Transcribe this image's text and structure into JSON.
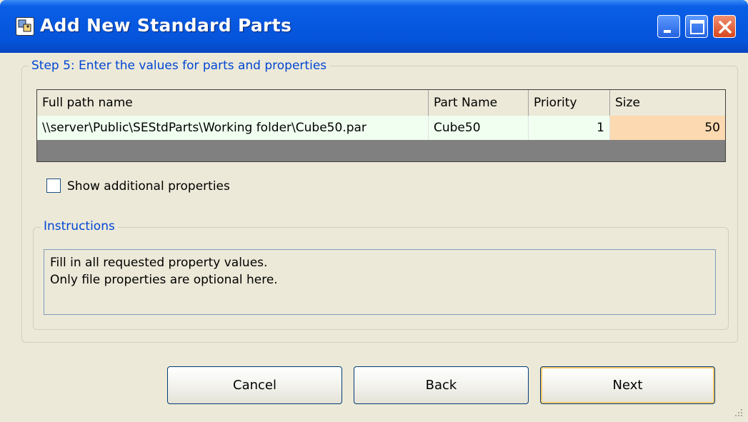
{
  "window": {
    "title": "Add New Standard Parts",
    "icon": "app-icon",
    "controls": [
      "minimize-icon",
      "maximize-icon",
      "close-icon"
    ]
  },
  "step": {
    "legend": "Step 5: Enter the values for parts and properties"
  },
  "grid": {
    "columns": [
      "Full path name",
      "Part Name",
      "Priority",
      "Size"
    ],
    "rows": [
      {
        "full_path": "\\\\server\\Public\\SEStdParts\\Working folder\\Cube50.par",
        "part_name": "Cube50",
        "priority": "1",
        "size": "50"
      }
    ]
  },
  "options": {
    "show_additional_label": "Show additional properties",
    "show_additional_checked": false
  },
  "instructions": {
    "legend": "Instructions",
    "line1": "Fill in all requested property values.",
    "line2": "Only file properties are optional here."
  },
  "buttons": {
    "cancel": "Cancel",
    "back": "Back",
    "next": "Next"
  },
  "colors": {
    "titlebar": "#0553d8",
    "group_legend": "#0046d5",
    "row_bg": "#f0fff0",
    "active_cell": "#fcd9b0"
  }
}
